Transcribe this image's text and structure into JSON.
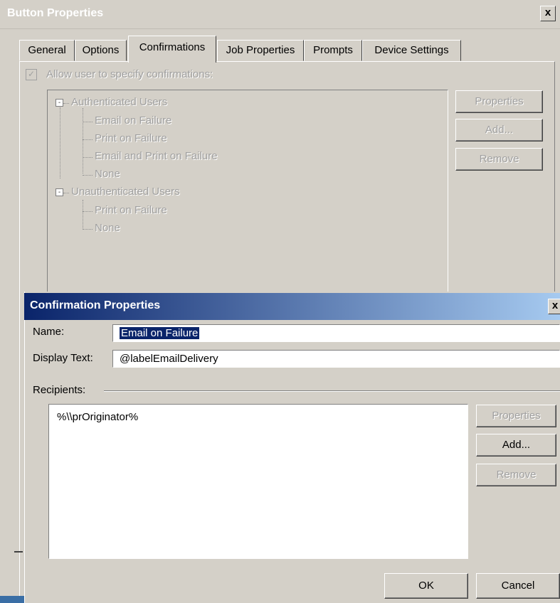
{
  "outer": {
    "title": "Button Properties",
    "close_label": "x",
    "tabs": [
      "General",
      "Options",
      "Confirmations",
      "Job Properties",
      "Prompts",
      "Device Settings"
    ],
    "allow_label": "Allow user to specify confirmations:",
    "allow_checked": true,
    "tree": {
      "groups": [
        {
          "label": "Authenticated Users",
          "expander": "-",
          "children": [
            "Email on Failure",
            "Print on Failure",
            "Email and Print on Failure",
            "None"
          ]
        },
        {
          "label": "Unauthenticated Users",
          "expander": "-",
          "children": [
            "Print on Failure",
            "None"
          ]
        }
      ]
    },
    "buttons": {
      "properties": "Properties",
      "add": "Add...",
      "remove": "Remove"
    }
  },
  "dialog": {
    "title": "Confirmation Properties",
    "close_label": "x",
    "name_label": "Name:",
    "name_value": "Email on Failure",
    "display_label": "Display Text:",
    "display_value": "@labelEmailDelivery",
    "recipients_label": "Recipients:",
    "recipients": [
      "%\\\\prOriginator%"
    ],
    "buttons": {
      "properties": "Properties",
      "add": "Add...",
      "remove": "Remove",
      "ok": "OK",
      "cancel": "Cancel"
    }
  },
  "colors": {
    "face": "#d4d0c8",
    "title_gradient_start": "#0a246a",
    "title_gradient_end": "#a6caf0",
    "disabled_text": "#a0a0a0",
    "selection": "#0a246a"
  }
}
